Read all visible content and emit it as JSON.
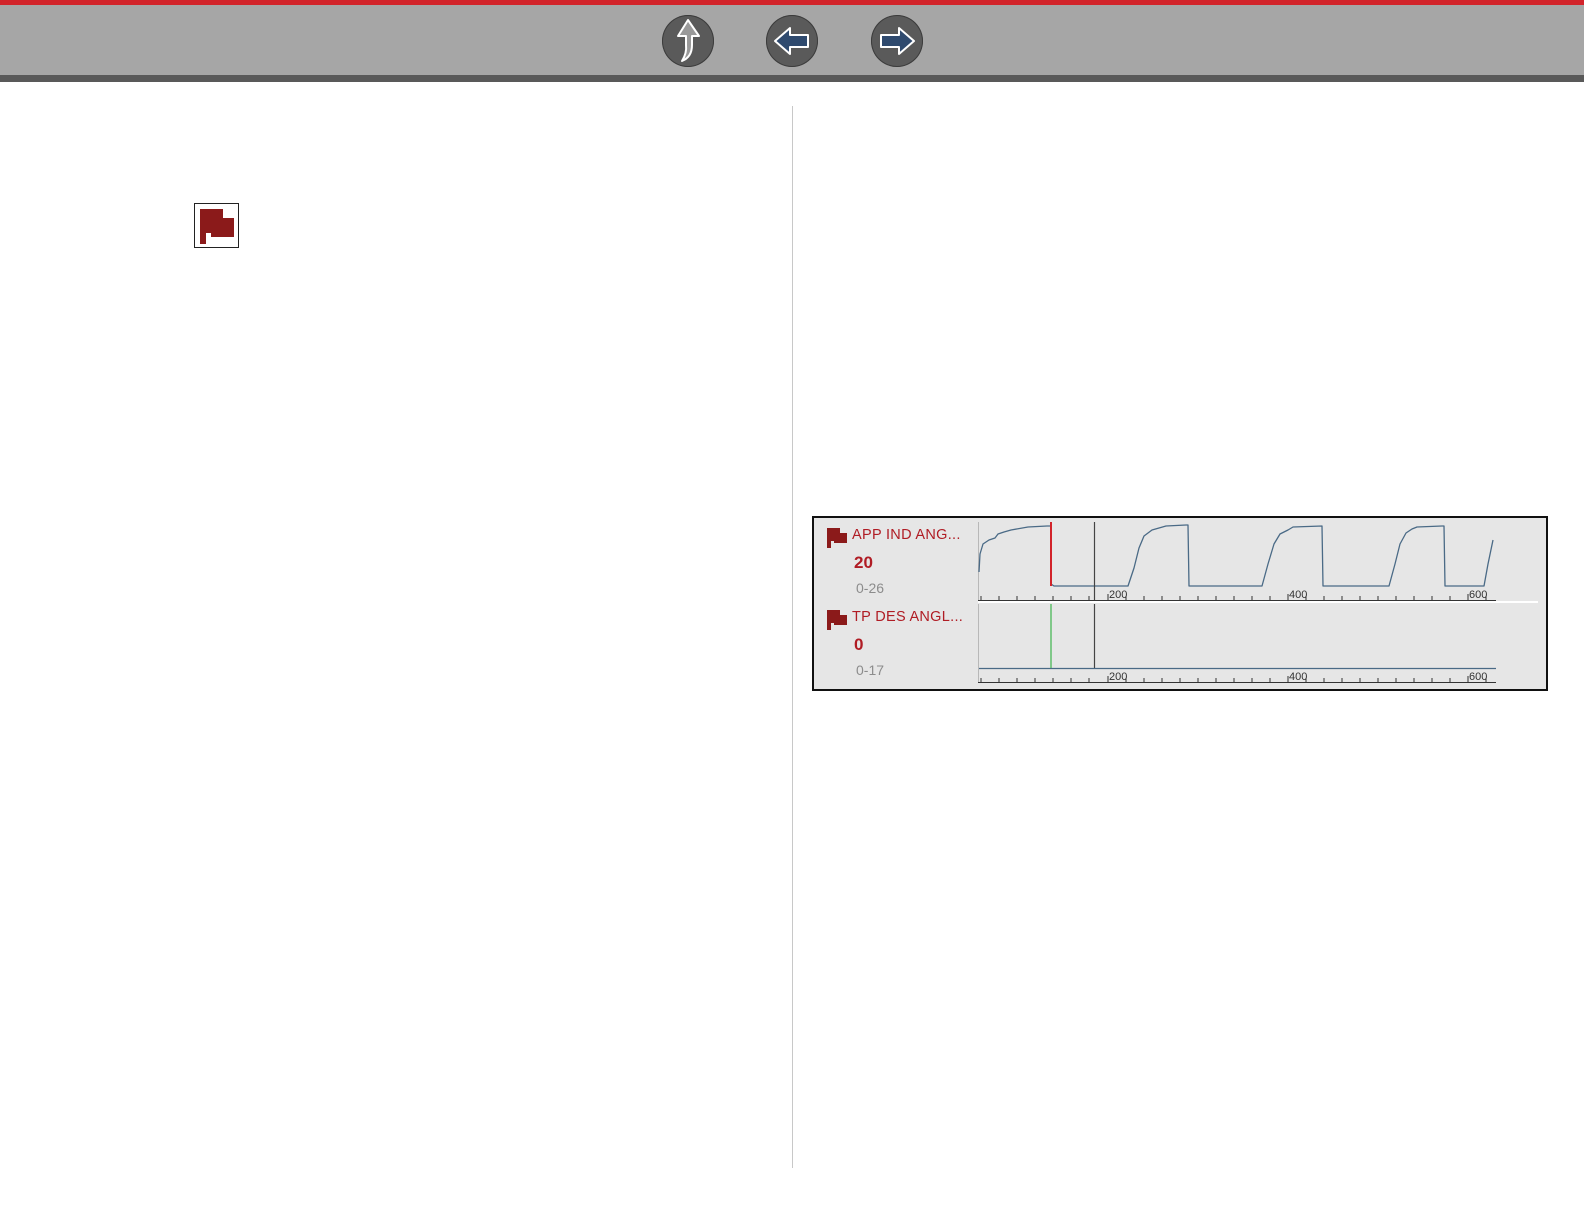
{
  "navigation": {
    "up_icon": "up-arrow-icon",
    "back_icon": "left-arrow-icon",
    "forward_icon": "right-arrow-icon"
  },
  "left_column": {
    "flag_icon": "flag-icon",
    "flag_color": "#8b1a1a"
  },
  "figure": {
    "rows": [
      {
        "name": "APP IND ANG...",
        "value": "20",
        "range": "0-26",
        "flag_icon": "flag-icon",
        "ticks": [
          "200",
          "400",
          "600"
        ]
      },
      {
        "name": "TP DES ANGL...",
        "value": "0",
        "range": "0-17",
        "flag_icon": "flag-icon",
        "ticks": [
          "200",
          "400",
          "600"
        ]
      }
    ],
    "colors": {
      "trace": "#4a6a86",
      "flag": "#8b1a1a",
      "label": "#b01c24",
      "cursor_red": "#d2232a",
      "cursor_green": "#3cb44b",
      "cursor_gray": "#444444"
    }
  }
}
